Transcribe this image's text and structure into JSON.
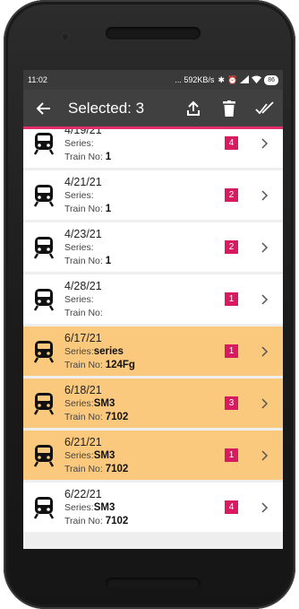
{
  "statusbar": {
    "time": "11:02",
    "network_speed": "... 592KB/s",
    "battery": "86"
  },
  "toolbar": {
    "title": "Selected: 3"
  },
  "colors": {
    "toolbar_bg": "#404040",
    "accent": "#e22d6a",
    "selected_bg": "#fbc97e",
    "badge_bg": "#d81b60"
  },
  "rows": [
    {
      "date": "4/19/21",
      "series_label": "Series:",
      "series": "",
      "train_label": "Train No:",
      "train": "1",
      "count": "4",
      "selected": false
    },
    {
      "date": "4/21/21",
      "series_label": "Series:",
      "series": "",
      "train_label": "Train No:",
      "train": "1",
      "count": "2",
      "selected": false
    },
    {
      "date": "4/23/21",
      "series_label": "Series:",
      "series": "",
      "train_label": "Train No:",
      "train": "1",
      "count": "2",
      "selected": false
    },
    {
      "date": "4/28/21",
      "series_label": "Series:",
      "series": "",
      "train_label": "Train No:",
      "train": "",
      "count": "1",
      "selected": false
    },
    {
      "date": "6/17/21",
      "series_label": "Series:",
      "series": "series",
      "train_label": "Train No:",
      "train": "124Fg",
      "count": "1",
      "selected": true
    },
    {
      "date": "6/18/21",
      "series_label": "Series:",
      "series": "SM3",
      "train_label": "Train No:",
      "train": "7102",
      "count": "3",
      "selected": true
    },
    {
      "date": "6/21/21",
      "series_label": "Series:",
      "series": "SM3",
      "train_label": "Train No:",
      "train": "7102",
      "count": "1",
      "selected": true
    },
    {
      "date": "6/22/21",
      "series_label": "Series:",
      "series": "SM3",
      "train_label": "Train No:",
      "train": "7102",
      "count": "4",
      "selected": false
    }
  ]
}
